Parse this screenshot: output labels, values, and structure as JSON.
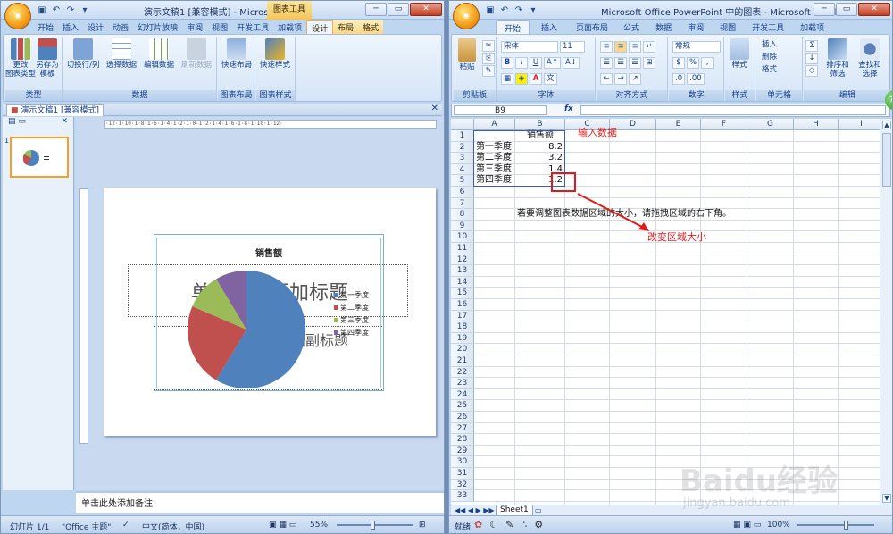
{
  "ppt": {
    "title": "演示文稿1 [兼容模式] - Microsoft Po...",
    "context_tab": "图表工具",
    "tabs": [
      "开始",
      "插入",
      "设计",
      "动画",
      "幻灯片放映",
      "审阅",
      "视图",
      "开发工具",
      "加载项",
      "设计",
      "布局",
      "格式"
    ],
    "groups": {
      "type": {
        "label": "类型",
        "buttons": [
          "更改\n图表类型",
          "另存为\n模板"
        ]
      },
      "data": {
        "label": "数据",
        "buttons": [
          "切换行/列",
          "选择数据",
          "编辑数据",
          "刷新数据"
        ]
      },
      "layout": {
        "label": "图表布局",
        "buttons": [
          "快速布局"
        ]
      },
      "style": {
        "label": "图表样式",
        "buttons": [
          "快速样式"
        ]
      }
    },
    "doc_tab": "演示文稿1 [兼容模式]",
    "slide_num": "1",
    "ghost_title": "单击此处添加标题",
    "ghost_sub": "单击此处添加副标题",
    "notes": "单击此处添加备注",
    "status": {
      "slide": "幻灯片 1/1",
      "theme": "\"Office 主题\"",
      "lang": "中文(简体，中国)",
      "zoom": "55%",
      "zoom_pct": 0.55
    }
  },
  "chart_data": {
    "type": "pie",
    "title": "销售额",
    "categories": [
      "第一季度",
      "第二季度",
      "第三季度",
      "第四季度"
    ],
    "values": [
      8.2,
      3.2,
      1.4,
      1.2
    ],
    "colors": [
      "#4f81bd",
      "#c0504d",
      "#9bbb59",
      "#8064a2"
    ],
    "legend": "right"
  },
  "xl": {
    "title": "Microsoft Office PowerPoint 中的图表 - Microsoft Excel",
    "tabs": [
      "开始",
      "插入",
      "页面布局",
      "公式",
      "数据",
      "审阅",
      "视图",
      "开发工具",
      "加载项"
    ],
    "font_name": "宋体",
    "font_size": "11",
    "number_format": "常规",
    "groups": [
      "剪贴板",
      "字体",
      "对齐方式",
      "数字",
      "样式",
      "单元格",
      "编辑"
    ],
    "buttons": {
      "paste": "粘贴",
      "style": "样式",
      "insert": "插入",
      "delete": "删除",
      "format": "格式",
      "sort": "排序和\n筛选",
      "find": "查找和\n选择"
    },
    "name_box": "B9",
    "fx": "fx",
    "columns": [
      "A",
      "B",
      "C",
      "D",
      "E",
      "F",
      "G",
      "H",
      "I"
    ],
    "header_b1": "销售额",
    "rows_data": [
      {
        "label": "第一季度",
        "value": "8.2"
      },
      {
        "label": "第二季度",
        "value": "3.2"
      },
      {
        "label": "第三季度",
        "value": "1.4"
      },
      {
        "label": "第四季度",
        "value": "1.2"
      }
    ],
    "note_row8": "若要调整图表数据区域的大小，请拖拽区域的右下角。",
    "sheet_tab": "Sheet1",
    "status_ready": "就绪",
    "zoom": "100%",
    "zoom_pct": 1.0
  },
  "annotations": {
    "input": "输入数据",
    "resize": "改变区域大小"
  },
  "watermark": {
    "main": "Baidu经验",
    "sub": "jingyan.baidu.com"
  }
}
